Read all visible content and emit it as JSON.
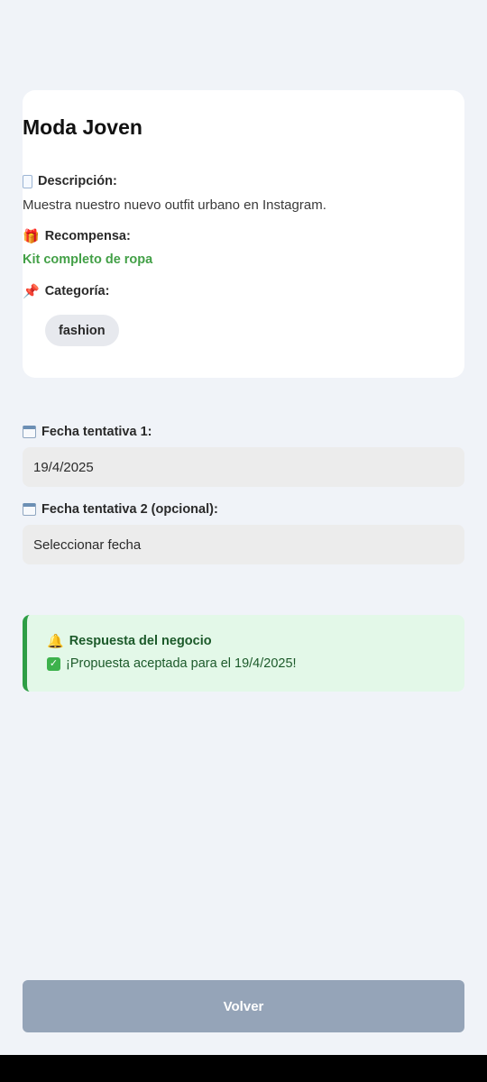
{
  "offer": {
    "title": "Moda Joven",
    "description_label": "Descripción:",
    "description": "Muestra nuestro nuevo outfit urbano en Instagram.",
    "reward_label": "Recompensa:",
    "reward": "Kit completo de ropa",
    "category_label": "Categoría:",
    "category": "fashion"
  },
  "dates": {
    "date1_label": "Fecha tentativa 1:",
    "date1_value": "19/4/2025",
    "date2_label": "Fecha tentativa 2 (opcional):",
    "date2_value": "Seleccionar fecha"
  },
  "response": {
    "title": "Respuesta del negocio",
    "message": "¡Propuesta aceptada para el 19/4/2025!"
  },
  "actions": {
    "back_label": "Volver"
  },
  "icons": {
    "description": "page-icon",
    "reward": "gift-icon",
    "category": "pushpin-icon",
    "date": "calendar-icon",
    "response": "bell-icon",
    "accepted": "check-mark-icon"
  },
  "colors": {
    "background": "#f0f3f8",
    "reward_text": "#43a047",
    "notice_background": "#e3f8e8",
    "notice_border": "#2e9e45",
    "back_button": "#95a4b8"
  }
}
